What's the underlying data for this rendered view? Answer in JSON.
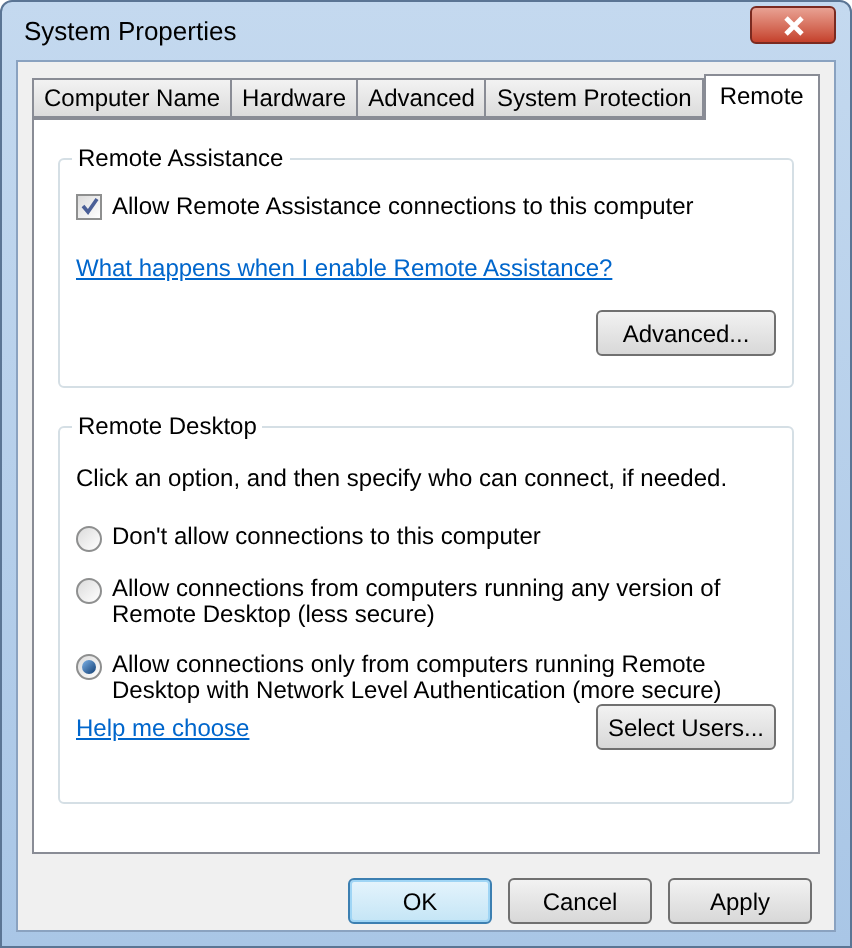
{
  "window": {
    "title": "System Properties"
  },
  "tabs": [
    {
      "label": "Computer Name",
      "selected": false
    },
    {
      "label": "Hardware",
      "selected": false
    },
    {
      "label": "Advanced",
      "selected": false
    },
    {
      "label": "System Protection",
      "selected": false
    },
    {
      "label": "Remote",
      "selected": true
    }
  ],
  "remote_assistance": {
    "title": "Remote Assistance",
    "checkbox": {
      "label": "Allow Remote Assistance connections to this computer",
      "checked": true
    },
    "link": "What happens when I enable Remote Assistance?",
    "button": "Advanced..."
  },
  "remote_desktop": {
    "title": "Remote Desktop",
    "instruction": "Click an option, and then specify who can connect, if needed.",
    "options": [
      {
        "label": "Don't allow connections to this computer",
        "selected": false
      },
      {
        "label": "Allow connections from computers running any version of Remote Desktop (less secure)",
        "selected": false
      },
      {
        "label": "Allow connections only from computers running Remote Desktop with Network Level Authentication (more secure)",
        "selected": true
      }
    ],
    "link": "Help me choose",
    "button": "Select Users..."
  },
  "buttons": [
    {
      "label": "OK",
      "default": true
    },
    {
      "label": "Cancel",
      "default": false
    },
    {
      "label": "Apply",
      "default": false
    }
  ]
}
